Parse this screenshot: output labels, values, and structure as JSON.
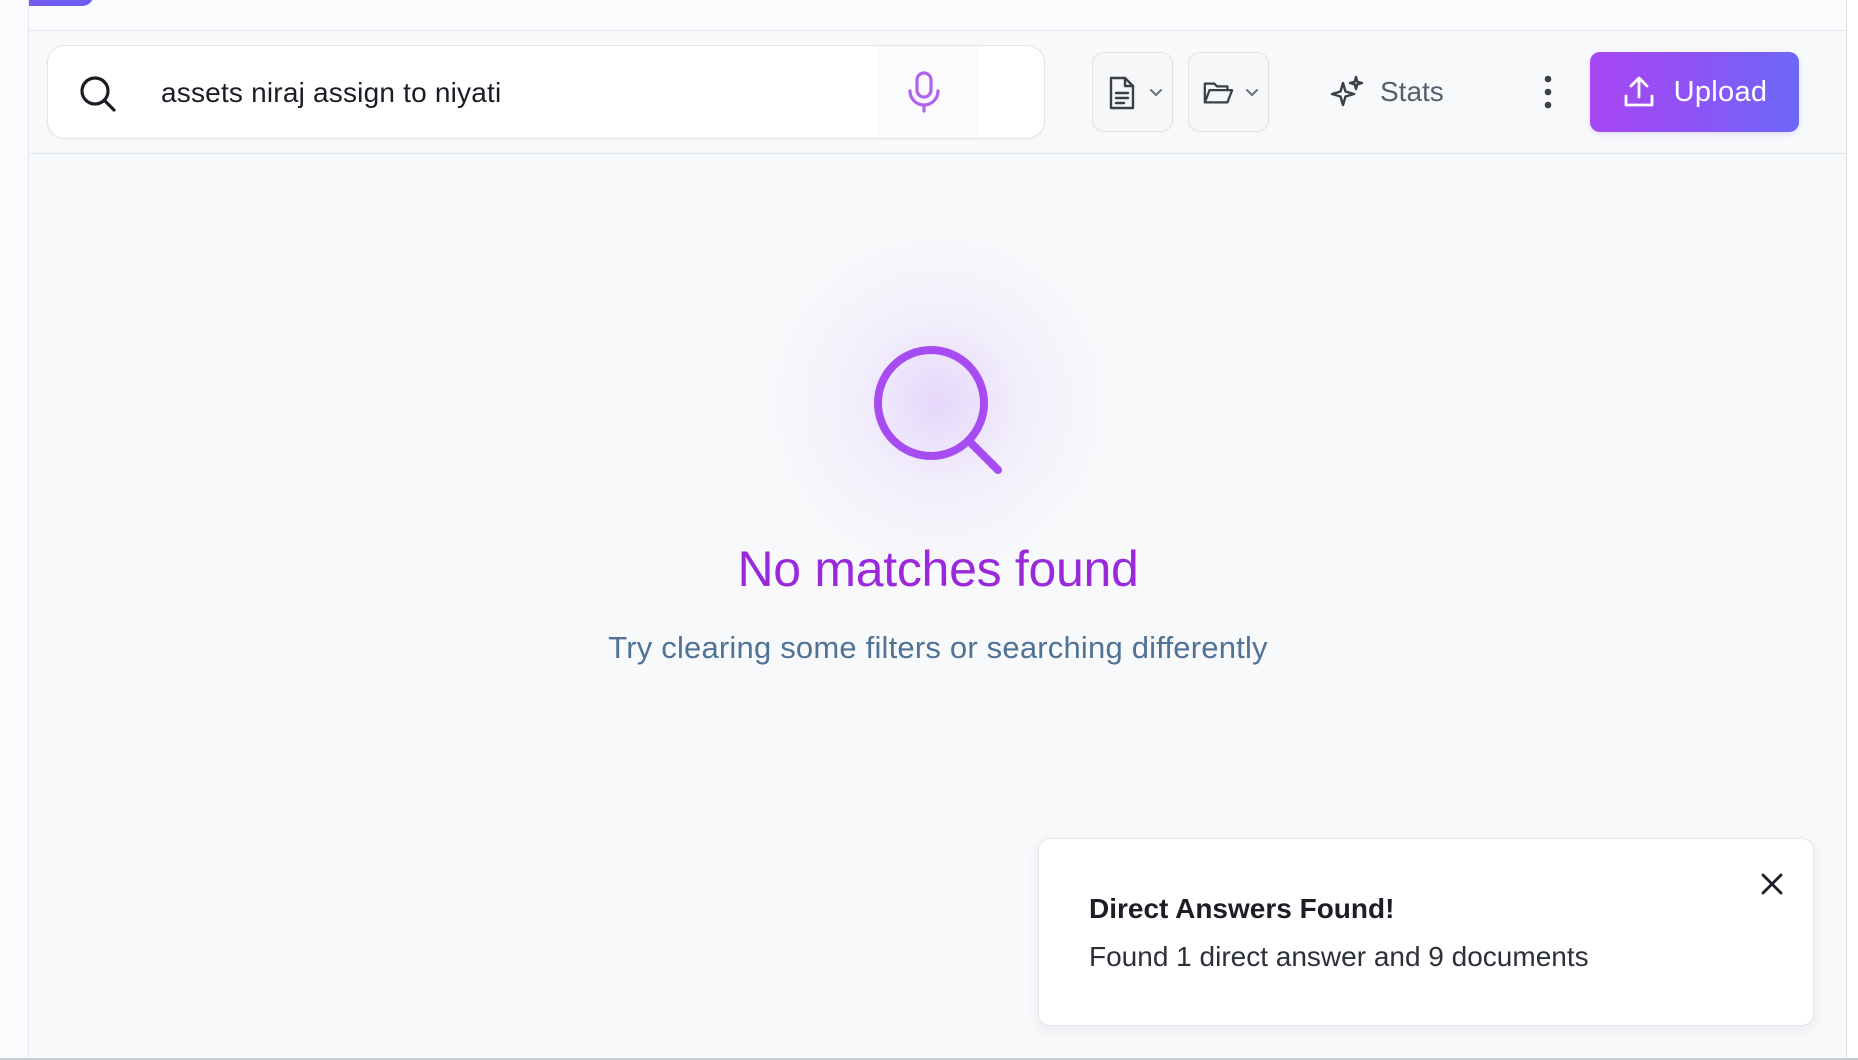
{
  "search": {
    "query": "assets niraj assign to niyati",
    "icon": "search-icon",
    "mic_icon": "microphone-icon"
  },
  "toolbar": {
    "doc_filter_icon": "document-icon",
    "folder_filter_icon": "folder-open-icon",
    "stats_label": "Stats",
    "stats_icon": "sparkles-icon",
    "more_icon": "kebab-menu-icon",
    "upload_label": "Upload",
    "upload_icon": "upload-icon"
  },
  "empty_state": {
    "icon": "search-icon",
    "title": "No matches found",
    "subtitle": "Try clearing some filters or searching differently"
  },
  "toast": {
    "title": "Direct Answers Found!",
    "message": "Found 1 direct answer and 9 documents",
    "close_icon": "close-icon"
  },
  "colors": {
    "accent": "#9a28dd",
    "upload_gradient_start": "#a746f3",
    "upload_gradient_end": "#6b68f7",
    "subtitle": "#4f7296"
  }
}
